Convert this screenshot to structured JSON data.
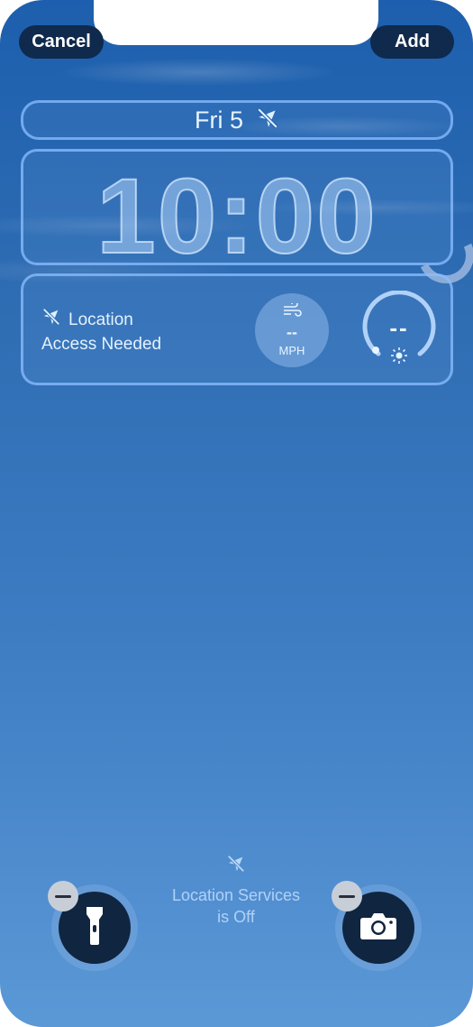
{
  "top_bar": {
    "cancel_label": "Cancel",
    "add_label": "Add"
  },
  "lock_screen": {
    "date": "Fri 5",
    "time": "10:00"
  },
  "widgets": {
    "location": {
      "line1": "Location",
      "line2": "Access Needed"
    },
    "wind": {
      "value": "--",
      "unit": "MPH"
    },
    "uv": {
      "value": "--"
    }
  },
  "status": {
    "line1": "Location Services",
    "line2": "is Off"
  },
  "quick_actions": [
    {
      "icon": "flashlight-icon"
    },
    {
      "icon": "camera-icon"
    }
  ],
  "colors": {
    "button_bg": "#0f2a4d",
    "widget_outline": "#8cbeff",
    "text": "#e7f4ff"
  }
}
